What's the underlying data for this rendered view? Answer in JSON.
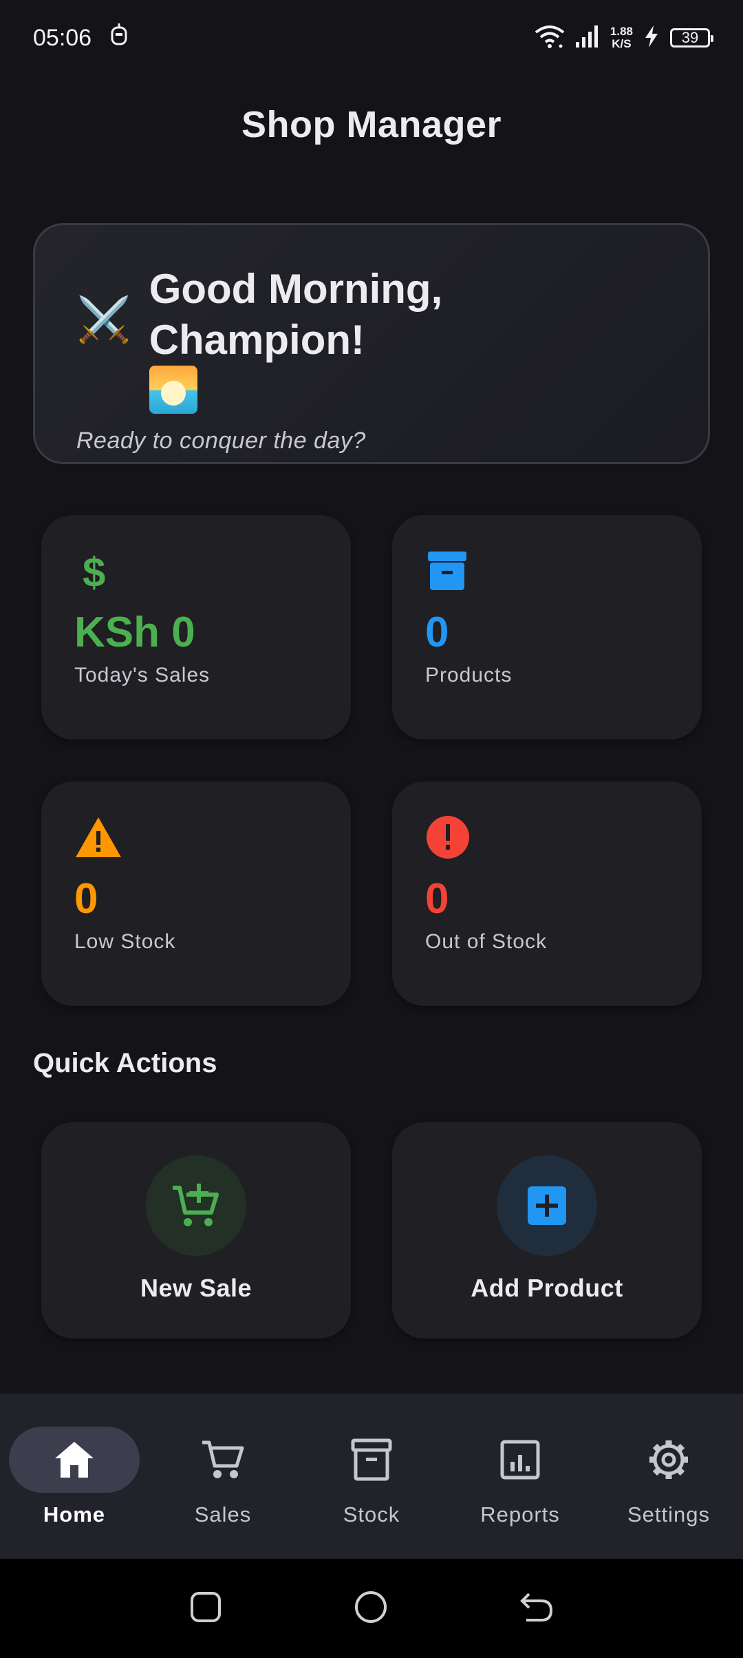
{
  "status_bar": {
    "time": "05:06",
    "net_speed_value": "1.88",
    "net_speed_unit": "K/S",
    "battery": "39"
  },
  "app": {
    "title": "Shop Manager"
  },
  "greeting": {
    "title": "Good Morning, Champion!",
    "subtitle": "Ready to conquer the day?",
    "emoji_left": "⚔️"
  },
  "stats": [
    {
      "value": "KSh 0",
      "label": "Today's Sales",
      "icon": "dollar-icon",
      "color": "#4caf50"
    },
    {
      "value": "0",
      "label": "Products",
      "icon": "archive-box-icon",
      "color": "#2196f3"
    },
    {
      "value": "0",
      "label": "Low Stock",
      "icon": "warning-triangle-icon",
      "color": "#ff9800"
    },
    {
      "value": "0",
      "label": "Out of Stock",
      "icon": "alert-circle-icon",
      "color": "#f44336"
    }
  ],
  "quick_actions": {
    "title": "Quick Actions",
    "items": [
      {
        "label": "New Sale",
        "icon": "cart-add-icon",
        "color": "#4caf50"
      },
      {
        "label": "Add Product",
        "icon": "plus-box-icon",
        "color": "#2196f3"
      }
    ]
  },
  "bottom_nav": {
    "items": [
      {
        "label": "Home",
        "icon": "home-icon",
        "active": true
      },
      {
        "label": "Sales",
        "icon": "cart-icon",
        "active": false
      },
      {
        "label": "Stock",
        "icon": "archive-icon",
        "active": false
      },
      {
        "label": "Reports",
        "icon": "chart-icon",
        "active": false
      },
      {
        "label": "Settings",
        "icon": "gear-icon",
        "active": false
      }
    ]
  }
}
